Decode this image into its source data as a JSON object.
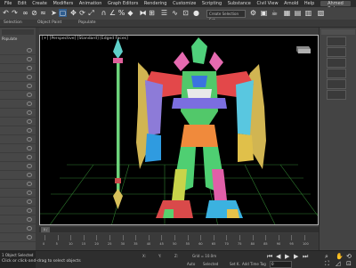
{
  "menubar": {
    "items": [
      "File",
      "Edit",
      "Create",
      "Modifiers",
      "Animation",
      "Graph Editors",
      "Rendering",
      "Customize",
      "Scripting",
      "Substance",
      "Civil View",
      "Arnold",
      "Help"
    ],
    "user": "Ahmed Bakeer"
  },
  "toolbar": {
    "selection_set": "Create Selection Set",
    "icons": [
      "undo-icon",
      "redo-icon",
      "link-icon",
      "unlink-icon",
      "bind-icon",
      "select-icon",
      "select-region-icon",
      "move-icon",
      "rotate-icon",
      "scale-icon",
      "snap-icon",
      "angle-snap-icon",
      "percent-snap-icon",
      "mirror-icon",
      "align-icon",
      "layer-icon",
      "curve-editor-icon",
      "schematic-icon",
      "material-editor-icon",
      "render-setup-icon",
      "render-icon"
    ]
  },
  "subbar": {
    "items": [
      "Selection",
      "Object Paint",
      "Populate"
    ]
  },
  "left_panel": {
    "header": "Populate"
  },
  "viewport": {
    "label": "[+] [Perspective] [Standard] [Edged Faces]",
    "background": "#000000",
    "border": "#b8b8b8"
  },
  "timeline": {
    "frame": "0 / 100",
    "ticks": [
      "0",
      "5",
      "10",
      "15",
      "20",
      "25",
      "30",
      "35",
      "40",
      "45",
      "50",
      "55",
      "60",
      "65",
      "70",
      "75",
      "80",
      "85",
      "90",
      "95",
      "100"
    ]
  },
  "status": {
    "selected": "1 Object Selected",
    "prompt": "Click or click-and-drag to select objects",
    "grid": "Grid = 10.0m",
    "x_label": "X:",
    "y_label": "Y:",
    "z_label": "Z:",
    "autokey": "Auto",
    "selected_label": "Selected",
    "set_key": "Set K.",
    "filters": "Filters...",
    "add_time_tag": "Add Time Tag",
    "frame_field": "0"
  },
  "colors": {
    "accent_blue": "#3a7bd5",
    "grid_green": "#2f7d2f"
  }
}
